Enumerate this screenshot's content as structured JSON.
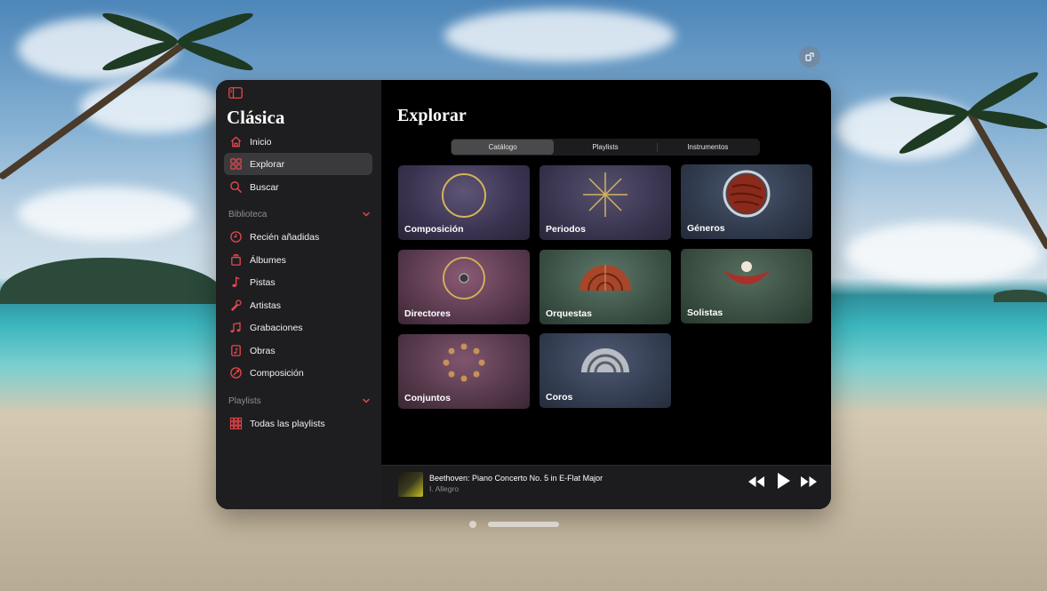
{
  "app": {
    "title": "Clásica"
  },
  "sidebar": {
    "nav": [
      {
        "label": "Inicio",
        "icon": "home-icon"
      },
      {
        "label": "Explorar",
        "icon": "grid-icon",
        "selected": true
      },
      {
        "label": "Buscar",
        "icon": "search-icon"
      }
    ],
    "library_header": "Biblioteca",
    "library": [
      {
        "label": "Recién añadidas",
        "icon": "clock-icon"
      },
      {
        "label": "Álbumes",
        "icon": "album-stack-icon"
      },
      {
        "label": "Pistas",
        "icon": "music-note-icon"
      },
      {
        "label": "Artistas",
        "icon": "microphone-icon"
      },
      {
        "label": "Grabaciones",
        "icon": "music-notes-icon"
      },
      {
        "label": "Obras",
        "icon": "sheet-music-icon"
      },
      {
        "label": "Composición",
        "icon": "quill-icon"
      }
    ],
    "playlists_header": "Playlists",
    "playlists": [
      {
        "label": "Todas las playlists",
        "icon": "playlists-grid-icon"
      }
    ]
  },
  "main": {
    "title": "Explorar",
    "segments": [
      {
        "label": "Catálogo",
        "active": true
      },
      {
        "label": "Playlists",
        "active": false
      },
      {
        "label": "Instrumentos",
        "active": false
      }
    ],
    "tiles": [
      {
        "label": "Composición"
      },
      {
        "label": "Periodos"
      },
      {
        "label": "Géneros"
      },
      {
        "label": "Directores"
      },
      {
        "label": "Orquestas"
      },
      {
        "label": "Solistas"
      },
      {
        "label": "Conjuntos"
      },
      {
        "label": "Coros"
      }
    ]
  },
  "player": {
    "track_title": "Beethoven: Piano Concerto No. 5 in E-Flat Major",
    "track_subtitle": "I. Allegro"
  },
  "colors": {
    "accent": "#e5484d",
    "sidebar_bg": "#1e1e20",
    "content_bg": "#000000"
  }
}
